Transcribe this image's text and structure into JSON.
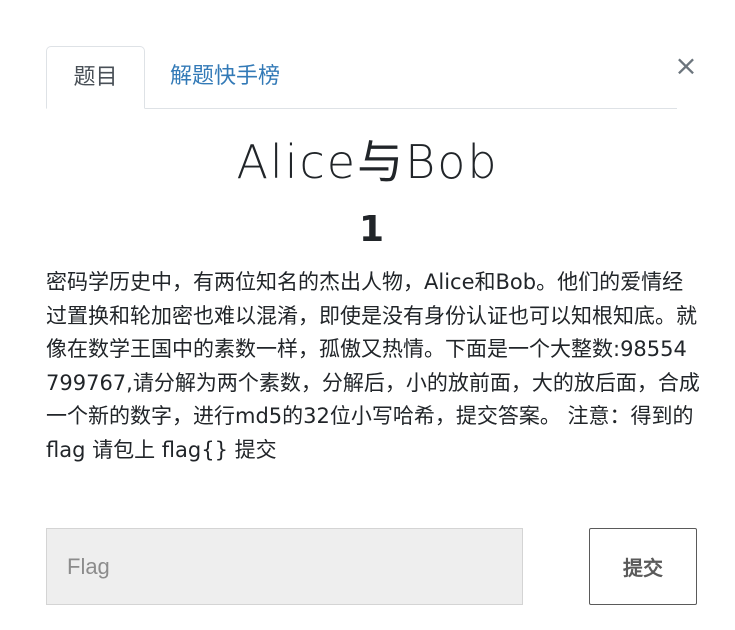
{
  "modal": {
    "close_glyph": "×"
  },
  "tabs": [
    {
      "label": "题目",
      "active": true
    },
    {
      "label": "解题快手榜",
      "active": false
    }
  ],
  "challenge": {
    "name": "Alice与Bob",
    "value": "1",
    "description": "密码学历史中，有两位知名的杰出人物，Alice和Bob。他们的爱情经过置换和轮加密也难以混淆，即使是没有身份认证也可以知根知底。就像在数学王国中的素数一样，孤傲又热情。下面是一个大整数:98554799767,请分解为两个素数，分解后，小的放前面，大的放后面，合成一个新的数字，进行md5的32位小写哈希，提交答案。 注意：得到的 flag 请包上 flag{} 提交"
  },
  "form": {
    "flag_placeholder": "Flag",
    "flag_value": "",
    "submit_label": "提交"
  },
  "colors": {
    "link": "#337ab7",
    "input_bg": "#eeeeee",
    "submit_border": "#5a5a5a"
  }
}
